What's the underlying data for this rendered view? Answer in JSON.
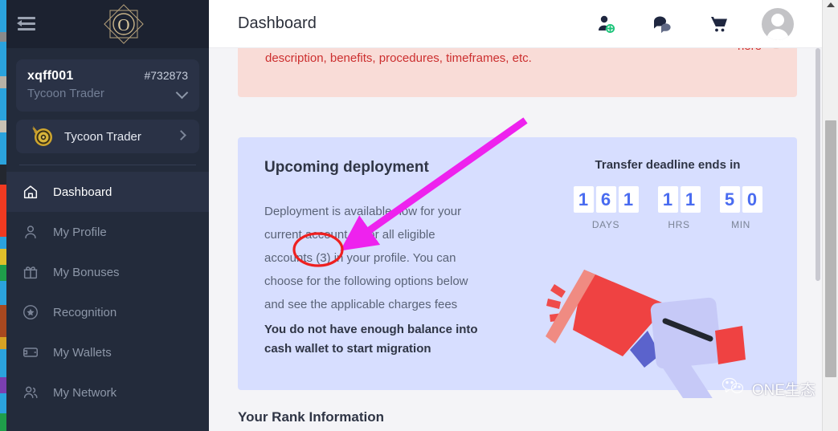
{
  "sidebar": {
    "logo_icon": "octagram-o-logo",
    "collapse_icon": "collapse-menu-icon",
    "account": {
      "name": "xqff001",
      "id": "#732873",
      "rank": "Tycoon Trader",
      "chevron_icon": "chevron-down-icon"
    },
    "rank_badge": {
      "label": "Tycoon Trader",
      "icon": "gold-medal-icon",
      "chevron_icon": "chevron-right-icon"
    },
    "items": [
      {
        "label": "Dashboard",
        "icon": "home-icon",
        "active": true
      },
      {
        "label": "My Profile",
        "icon": "user-icon",
        "active": false
      },
      {
        "label": "My Bonuses",
        "icon": "gift-icon",
        "active": false
      },
      {
        "label": "Recognition",
        "icon": "star-badge-icon",
        "active": false
      },
      {
        "label": "My Wallets",
        "icon": "wallet-icon",
        "active": false
      },
      {
        "label": "My Network",
        "icon": "users-icon",
        "active": false
      }
    ]
  },
  "header": {
    "title": "Dashboard",
    "icons": [
      {
        "name": "add-person-icon"
      },
      {
        "name": "chat-bubbles-icon"
      },
      {
        "name": "shopping-cart-icon"
      },
      {
        "name": "avatar"
      }
    ]
  },
  "alert": {
    "text": "description, benefits, procedures, timeframes, etc.",
    "link": "here",
    "close_icon": "close-icon",
    "bg_color": "#f9dcd7",
    "text_color": "#cc2f2f"
  },
  "deployment": {
    "title": "Upcoming deployment",
    "body": "Deployment is available now for your current account or for all eligible accounts (3) in your profile. You can choose for the following options below and see the applicable charges fees",
    "warning": "You do not have enough balance into cash wallet to start migration",
    "bg_color": "#d7deff",
    "illustration_icon": "megaphone-illustration"
  },
  "countdown": {
    "title": "Transfer deadline ends in",
    "groups": [
      {
        "digits": [
          "1",
          "6",
          "1"
        ],
        "label": "DAYS"
      },
      {
        "digits": [
          "1",
          "1"
        ],
        "label": "HRS"
      },
      {
        "digits": [
          "5",
          "0"
        ],
        "label": "MIN"
      }
    ],
    "digit_color": "#4a6cf0"
  },
  "rank_section": {
    "heading": "Your Rank Information"
  },
  "watermark": {
    "text": "ONE生态",
    "icon": "wechat-icon"
  },
  "annotations": {
    "arrow_color": "#ee22ee",
    "ellipse_color": "#ee2020",
    "highlighted_text": "(3)"
  },
  "scrollbar": {
    "up_arrow_icon": "scroll-up-arrow-icon",
    "thumb_name": "browser-scroll-thumb"
  }
}
